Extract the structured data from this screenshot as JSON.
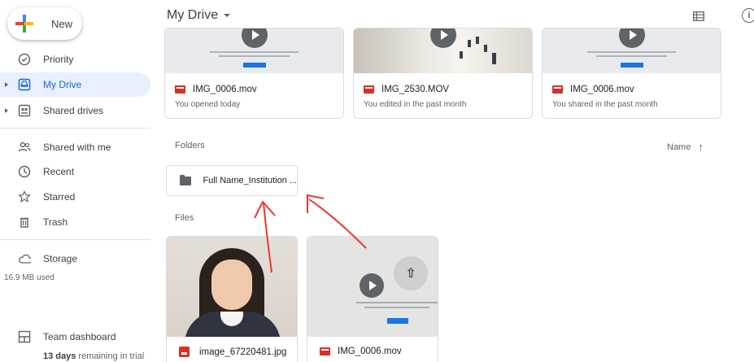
{
  "sidebar": {
    "new_label": "New",
    "items": [
      {
        "label": "Priority",
        "icon": "check-circle-icon"
      },
      {
        "label": "My Drive",
        "icon": "my-drive-icon"
      },
      {
        "label": "Shared drives",
        "icon": "shared-drives-icon"
      },
      {
        "label": "Shared with me",
        "icon": "people-icon"
      },
      {
        "label": "Recent",
        "icon": "clock-icon"
      },
      {
        "label": "Starred",
        "icon": "star-icon"
      },
      {
        "label": "Trash",
        "icon": "trash-icon"
      },
      {
        "label": "Storage",
        "icon": "cloud-icon"
      },
      {
        "label": "Team dashboard",
        "icon": "dashboard-icon"
      }
    ],
    "storage_used": "16.9 MB used",
    "trial_days": "13 days",
    "trial_rest": " remaining in trial"
  },
  "header": {
    "title": "My Drive"
  },
  "quick_access": [
    {
      "name": "IMG_0006.mov",
      "sub": "You opened today"
    },
    {
      "name": "IMG_2530.MOV",
      "sub": "You edited in the past month"
    },
    {
      "name": "IMG_0006.mov",
      "sub": "You shared in the past month"
    }
  ],
  "sections": {
    "folders": "Folders",
    "files": "Files",
    "sort_label": "Name",
    "sort_arrow": "↑"
  },
  "folders": [
    {
      "name": "Full Name_Institution ..."
    }
  ],
  "files": [
    {
      "name": "image_67220481.jpg"
    },
    {
      "name": "IMG_0006.mov"
    }
  ],
  "colors": {
    "accent": "#1967d2",
    "active_bg": "#e8f0fe",
    "file_red": "#d93025",
    "annotation": "#e53935"
  }
}
